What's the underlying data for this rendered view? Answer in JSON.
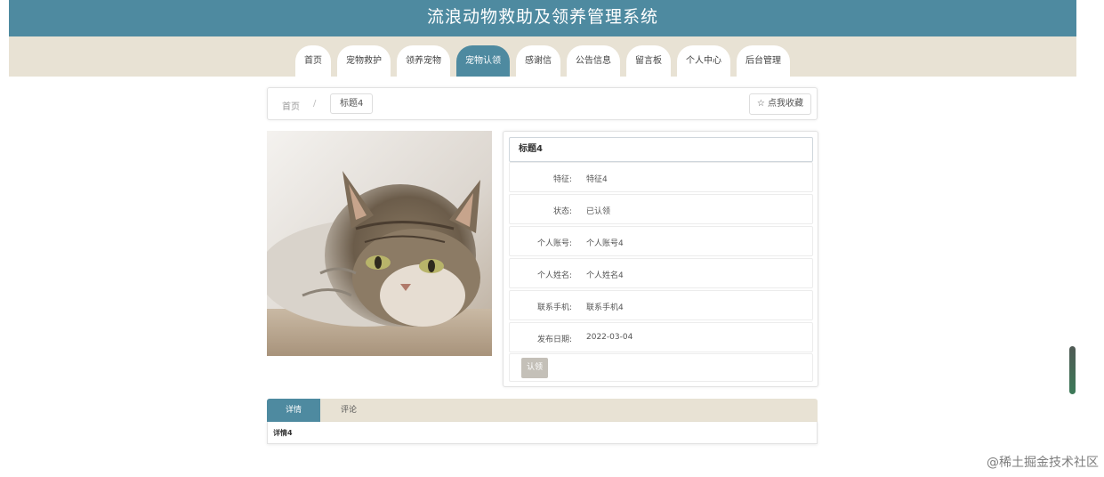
{
  "header": {
    "title": "流浪动物救助及领养管理系统"
  },
  "nav": {
    "tabs": [
      {
        "label": "首页",
        "active": false
      },
      {
        "label": "宠物救护",
        "active": false
      },
      {
        "label": "领养宠物",
        "active": false
      },
      {
        "label": "宠物认领",
        "active": true
      },
      {
        "label": "感谢信",
        "active": false
      },
      {
        "label": "公告信息",
        "active": false
      },
      {
        "label": "留言板",
        "active": false
      },
      {
        "label": "个人中心",
        "active": false
      },
      {
        "label": "后台管理",
        "active": false
      }
    ],
    "active_color": "#4e8aa0",
    "bar_color": "#e8e2d4"
  },
  "breadcrumb": {
    "home": "首页",
    "separator": "/",
    "current": "标题4",
    "favorite_icon": "star-icon",
    "favorite_label": "☆ 点我收藏"
  },
  "pet": {
    "image": "cat-photo",
    "title": "标题4",
    "fields": [
      {
        "label": "特征:",
        "value": "特征4"
      },
      {
        "label": "状态:",
        "value": "已认领"
      },
      {
        "label": "个人账号:",
        "value": "个人账号4"
      },
      {
        "label": "个人姓名:",
        "value": "个人姓名4"
      },
      {
        "label": "联系手机:",
        "value": "联系手机4"
      },
      {
        "label": "发布日期:",
        "value": "2022-03-04"
      }
    ],
    "adopt_button": "认领"
  },
  "detail": {
    "tabs": [
      {
        "label": "详情",
        "active": true
      },
      {
        "label": "评论",
        "active": false
      }
    ],
    "content": "详情4"
  },
  "watermark": "@稀土掘金技术社区"
}
